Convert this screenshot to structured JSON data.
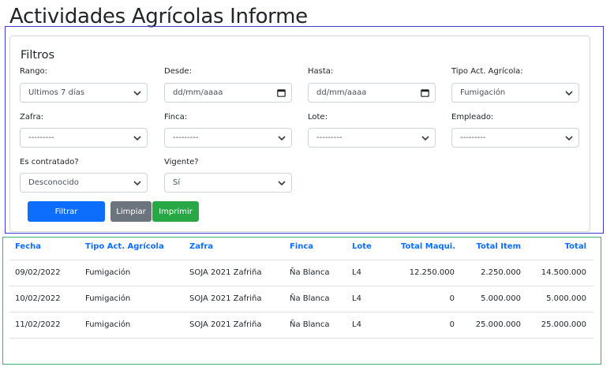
{
  "page": {
    "title": "Actividades Agrícolas Informe"
  },
  "filters": {
    "title": "Filtros",
    "rango": {
      "label": "Rango:",
      "value": "Últimos 7 días"
    },
    "desde": {
      "label": "Desde:",
      "value": "dd/mm/aaaa"
    },
    "hasta": {
      "label": "Hasta:",
      "value": "dd/mm/aaaa"
    },
    "tipo": {
      "label": "Tipo Act. Agrícola:",
      "value": "Fumigación"
    },
    "zafra": {
      "label": "Zafra:",
      "value": "---------"
    },
    "finca": {
      "label": "Finca:",
      "value": "---------"
    },
    "lote": {
      "label": "Lote:",
      "value": "---------"
    },
    "empleado": {
      "label": "Empleado:",
      "value": "---------"
    },
    "contratado": {
      "label": "Es contratado?",
      "value": "Desconocido"
    },
    "vigente": {
      "label": "Vigente?",
      "value": "Sí"
    },
    "buttons": {
      "filtrar": "Filtrar",
      "limpiar": "Limpiar",
      "imprimir": "Imprimir"
    }
  },
  "table": {
    "headers": {
      "fecha": "Fecha",
      "tipo": "Tipo Act. Agrícola",
      "zafra": "Zafra",
      "finca": "Finca",
      "lote": "Lote",
      "total_maqui": "Total Maqui.",
      "total_item": "Total Item",
      "total": "Total"
    },
    "rows": [
      {
        "fecha": "09/02/2022",
        "tipo": "Fumigación",
        "zafra": "SOJA 2021 Zafriña",
        "finca": "Ña Blanca",
        "lote": "L4",
        "total_maqui": "12.250.000",
        "total_item": "2.250.000",
        "total": "14.500.000"
      },
      {
        "fecha": "10/02/2022",
        "tipo": "Fumigación",
        "zafra": "SOJA 2021 Zafriña",
        "finca": "Ña Blanca",
        "lote": "L4",
        "total_maqui": "0",
        "total_item": "5.000.000",
        "total": "5.000.000"
      },
      {
        "fecha": "11/02/2022",
        "tipo": "Fumigación",
        "zafra": "SOJA 2021 Zafriña",
        "finca": "Ña Blanca",
        "lote": "L4",
        "total_maqui": "0",
        "total_item": "25.000.000",
        "total": "25.000.000"
      }
    ]
  },
  "colors": {
    "primary": "#0d6efd",
    "secondary": "#6c757d",
    "success": "#28a745",
    "outline_blue": "#3b3bd0",
    "outline_green": "#3cb371"
  },
  "icons": {
    "select": "chevron-down-icon",
    "date": "calendar-icon"
  }
}
